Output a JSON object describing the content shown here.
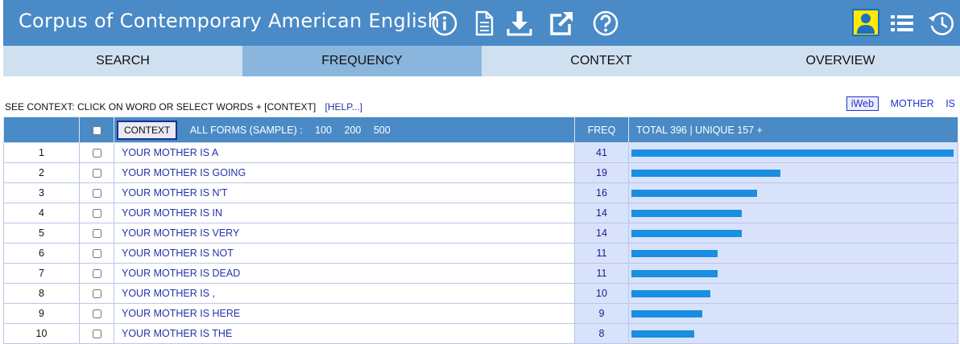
{
  "app": {
    "title": "Corpus of Contemporary American English"
  },
  "header_icons": [
    "info-icon",
    "document-icon",
    "download-icon",
    "external-link-icon",
    "help-icon",
    "user-icon",
    "list-icon",
    "history-icon"
  ],
  "colors": {
    "header_bg": "#4a8ac6",
    "tab_bg": "#cfe0f1",
    "tab_active_bg": "#8ab6de",
    "bar": "#1a8ee0",
    "freq_bg": "#d9e2fb",
    "link": "#2233aa",
    "user_icon_bg": "#ffea00"
  },
  "tabs": [
    {
      "label": "SEARCH",
      "active": false
    },
    {
      "label": "FREQUENCY",
      "active": true
    },
    {
      "label": "CONTEXT",
      "active": false
    },
    {
      "label": "OVERVIEW",
      "active": false
    }
  ],
  "info": {
    "text": "SEE CONTEXT: CLICK ON WORD OR SELECT WORDS + [CONTEXT]",
    "help": "[HELP...]"
  },
  "right_links": {
    "iweb": "iWeb",
    "word1": "MOTHER",
    "word2": "IS"
  },
  "table_header": {
    "context_button": "CONTEXT",
    "forms_label": "ALL FORMS  (SAMPLE) :",
    "n100": "100",
    "n200": "200",
    "n500": "500",
    "freq": "FREQ",
    "total": "TOTAL 396  |  UNIQUE 157  +"
  },
  "rows": [
    {
      "rank": "1",
      "text": "YOUR MOTHER IS A",
      "freq": 41
    },
    {
      "rank": "2",
      "text": "YOUR MOTHER IS GOING",
      "freq": 19
    },
    {
      "rank": "3",
      "text": "YOUR MOTHER IS N'T",
      "freq": 16
    },
    {
      "rank": "4",
      "text": "YOUR MOTHER IS IN",
      "freq": 14
    },
    {
      "rank": "5",
      "text": "YOUR MOTHER IS VERY",
      "freq": 14
    },
    {
      "rank": "6",
      "text": "YOUR MOTHER IS NOT",
      "freq": 11
    },
    {
      "rank": "7",
      "text": "YOUR MOTHER IS DEAD",
      "freq": 11
    },
    {
      "rank": "8",
      "text": "YOUR MOTHER IS ,",
      "freq": 10
    },
    {
      "rank": "9",
      "text": "YOUR MOTHER IS HERE",
      "freq": 9
    },
    {
      "rank": "10",
      "text": "YOUR MOTHER IS THE",
      "freq": 8
    }
  ]
}
